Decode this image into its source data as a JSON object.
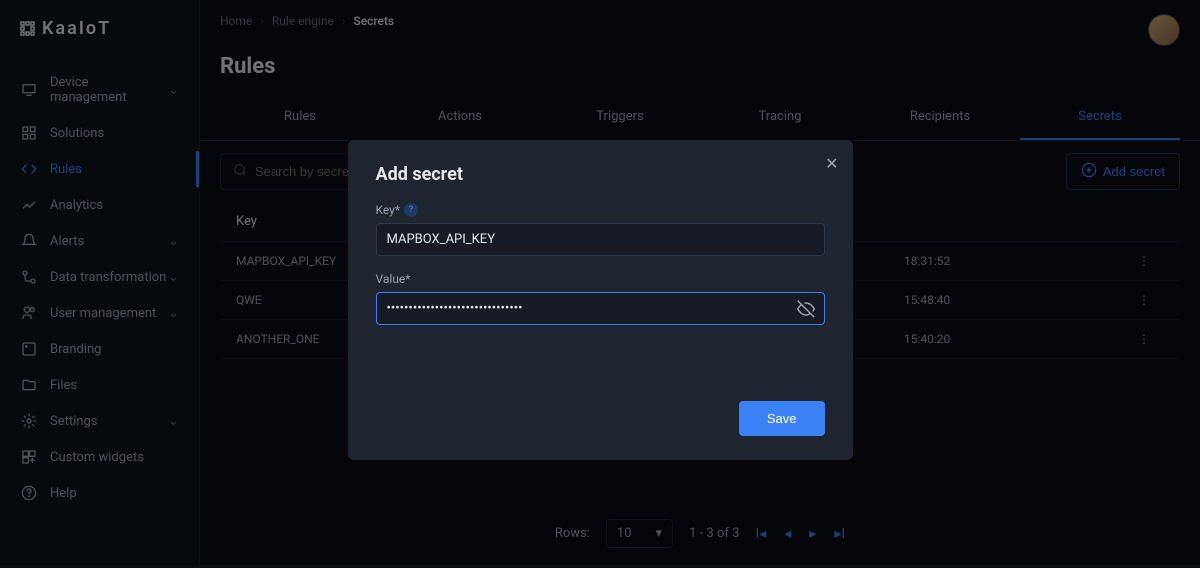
{
  "brand": "KaaIoT",
  "breadcrumb": {
    "home": "Home",
    "rule_engine": "Rule engine",
    "secrets": "Secrets"
  },
  "page_title": "Rules",
  "sidebar": {
    "items": [
      {
        "label": "Device management",
        "expandable": true
      },
      {
        "label": "Solutions",
        "expandable": false
      },
      {
        "label": "Rules",
        "expandable": false,
        "active": true
      },
      {
        "label": "Analytics",
        "expandable": false
      },
      {
        "label": "Alerts",
        "expandable": true
      },
      {
        "label": "Data transformation",
        "expandable": true
      },
      {
        "label": "User management",
        "expandable": true
      },
      {
        "label": "Branding",
        "expandable": false
      },
      {
        "label": "Files",
        "expandable": false
      },
      {
        "label": "Settings",
        "expandable": true
      },
      {
        "label": "Custom widgets",
        "expandable": false
      },
      {
        "label": "Help",
        "expandable": false
      }
    ]
  },
  "tabs": [
    {
      "label": "Rules"
    },
    {
      "label": "Actions"
    },
    {
      "label": "Triggers"
    },
    {
      "label": "Tracing"
    },
    {
      "label": "Recipients"
    },
    {
      "label": "Secrets",
      "active": true
    }
  ],
  "search": {
    "placeholder": "Search by secret key"
  },
  "add_button": "Add secret",
  "table": {
    "header_key": "Key",
    "rows": [
      {
        "key": "MAPBOX_API_KEY",
        "date": "18:31:52"
      },
      {
        "key": "QWE",
        "date": "15:48:40"
      },
      {
        "key": "ANOTHER_ONE",
        "date": "15:40:20"
      }
    ]
  },
  "pagination": {
    "rows_label": "Rows:",
    "rows_value": "10",
    "range": "1 - 3 of 3"
  },
  "modal": {
    "title": "Add secret",
    "key_label": "Key*",
    "key_value": "MAPBOX_API_KEY",
    "value_label": "Value*",
    "value_masked": "•••••••••••••••••••••••••••••••",
    "save": "Save"
  }
}
